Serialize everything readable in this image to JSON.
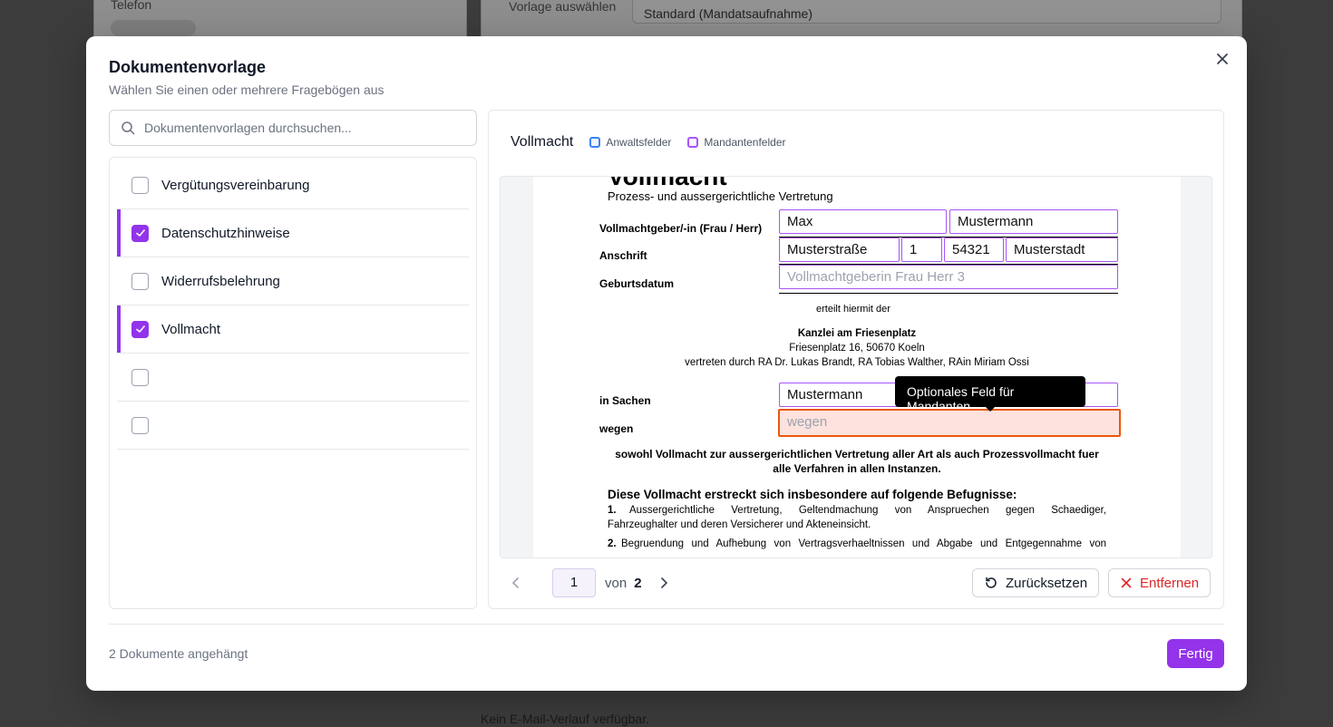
{
  "background": {
    "left_label": "Telefon",
    "right_label": "Vorlage auswählen",
    "select_value": "Standard (Mandatsaufnahme)",
    "footer_text": "Kein E-Mail-Verlauf verfügbar."
  },
  "modal": {
    "title": "Dokumentenvorlage",
    "subtitle": "Wählen Sie einen oder mehrere Fragebögen aus",
    "close_icon": "close-icon",
    "search": {
      "placeholder": "Dokumentenvorlagen durchsuchen...",
      "value": ""
    },
    "templates": [
      {
        "label": "Vergütungsvereinbarung",
        "checked": false
      },
      {
        "label": "Datenschutzhinweise",
        "checked": true
      },
      {
        "label": "Widerrufsbelehrung",
        "checked": false
      },
      {
        "label": "Vollmacht",
        "checked": true
      },
      {
        "label": "",
        "checked": false
      },
      {
        "label": "",
        "checked": false
      }
    ],
    "preview": {
      "title": "Vollmacht",
      "legend": [
        {
          "label": "Anwaltsfelder",
          "color": "#3b82f6"
        },
        {
          "label": "Mandantenfelder",
          "color": "#a855f7"
        }
      ],
      "document": {
        "heading": "Vollmacht",
        "subheading": "Prozess- und aussergerichtliche Vertretung",
        "labels": {
          "grantor": "Vollmachtgeber/-in (Frau / Herr)",
          "address": "Anschrift",
          "birthdate": "Geburtsdatum",
          "in_case": "in Sachen",
          "regarding": "wegen"
        },
        "fields": {
          "first_name": "Max",
          "last_name": "Mustermann",
          "street": "Musterstraße",
          "house_no": "1",
          "zip": "54321",
          "city": "Musterstadt",
          "birthdate_placeholder": "Vollmachtgeberin Frau Herr 3",
          "in_case_value": "Mustermann",
          "regarding_placeholder": "wegen"
        },
        "grant_text": "erteilt hiermit der",
        "firm_name": "Kanzlei am Friesenplatz",
        "firm_address": "Friesenplatz 16, 50670 Koeln",
        "firm_represented": "vertreten durch RA Dr. Lukas Brandt, RA Tobias Walther, RAin Miriam Ossi",
        "scope_line1": "sowohl Vollmacht zur aussergerichtlichen Vertretung aller Art als auch Prozessvollmacht fuer",
        "scope_line2": "alle Verfahren in allen Instanzen.",
        "powers_heading": "Diese Vollmacht erstreckt sich insbesondere auf folgende Befugnisse:",
        "power1_num": "1.",
        "power1_line1": "Aussergerichtliche Vertretung, Geltendmachung von Anspruechen gegen Schaediger,",
        "power1_line2": "Fahrzeughalter und deren Versicherer und Akteneinsicht.",
        "power2_num": "2.",
        "power2_line1": "Begruendung und Aufhebung von Vertragsverhaeltnissen und Abgabe und Entgegennahme von"
      },
      "tooltip": "Optionales Feld für Mandanten",
      "pager": {
        "current": "1",
        "of_label": "von",
        "total": "2"
      },
      "reset_label": "Zurücksetzen",
      "remove_label": "Entfernen"
    },
    "footer": {
      "status": "2 Dokumente angehängt",
      "done_label": "Fertig"
    }
  }
}
